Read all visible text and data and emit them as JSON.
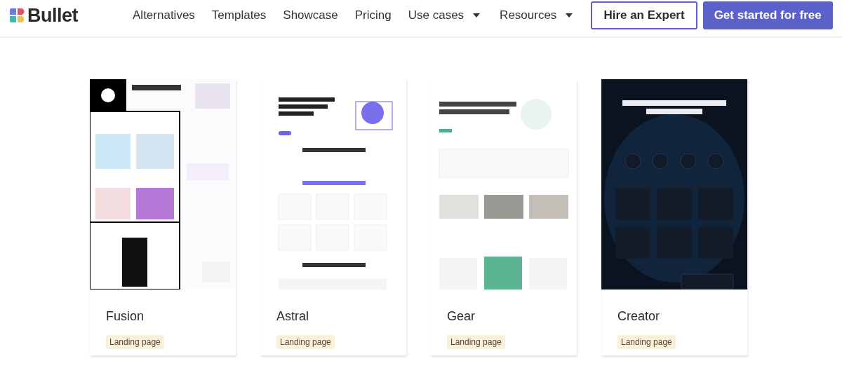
{
  "brand": {
    "name": "Bullet"
  },
  "nav": [
    {
      "label": "Alternatives",
      "dropdown": false
    },
    {
      "label": "Templates",
      "dropdown": false
    },
    {
      "label": "Showcase",
      "dropdown": false
    },
    {
      "label": "Pricing",
      "dropdown": false
    },
    {
      "label": "Use cases",
      "dropdown": true
    },
    {
      "label": "Resources",
      "dropdown": true
    }
  ],
  "buttons": [
    {
      "label": "Hire an Expert",
      "kind": "outline"
    },
    {
      "label": "Get started for free",
      "kind": "primary"
    }
  ],
  "templates": [
    {
      "name": "Fusion",
      "tag": "Landing page"
    },
    {
      "name": "Astral",
      "tag": "Landing page"
    },
    {
      "name": "Gear",
      "tag": "Landing page"
    },
    {
      "name": "Creator",
      "tag": "Landing page"
    }
  ]
}
